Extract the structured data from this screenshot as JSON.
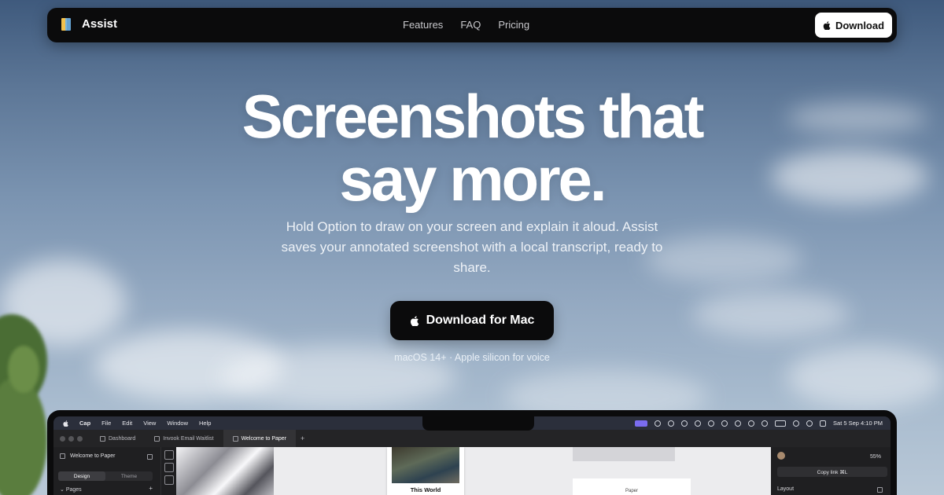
{
  "nav": {
    "brand": "Assist",
    "links": [
      "Features",
      "FAQ",
      "Pricing"
    ],
    "download_label": "Download"
  },
  "hero": {
    "title_line1": "Screenshots that",
    "title_line2": "say more.",
    "subtitle": "Hold Option to draw on your screen and explain it aloud. Assist saves your annotated screenshot with a local transcript, ready to share.",
    "cta_label": "Download for Mac",
    "requirements": "macOS 14+ · Apple silicon for voice"
  },
  "mockup": {
    "menubar": {
      "items": [
        "Cap",
        "File",
        "Edit",
        "View",
        "Window",
        "Help"
      ],
      "clock": "Sat 5 Sep  4:10 PM"
    },
    "tabs": [
      "Dashboard",
      "Invook Email Waitlist",
      "Welcome to Paper"
    ],
    "left_panel": {
      "title": "Welcome to Paper",
      "segments": [
        "Design",
        "Theme"
      ],
      "pages_label": "Pages"
    },
    "canvas": {
      "card_title": "This World",
      "card2_title": "Paper"
    },
    "right_panel": {
      "zoom": "55%",
      "copy_link": "Copy link  ⌘L",
      "layout_label": "Layout"
    }
  },
  "colors": {
    "nav_bg": "#0b0b0c",
    "cta_bg": "#0b0b0c",
    "sky_top": "#3f5a7d",
    "sky_bottom": "#b9c8d7",
    "menubar_selected": "#7a6cf0"
  }
}
